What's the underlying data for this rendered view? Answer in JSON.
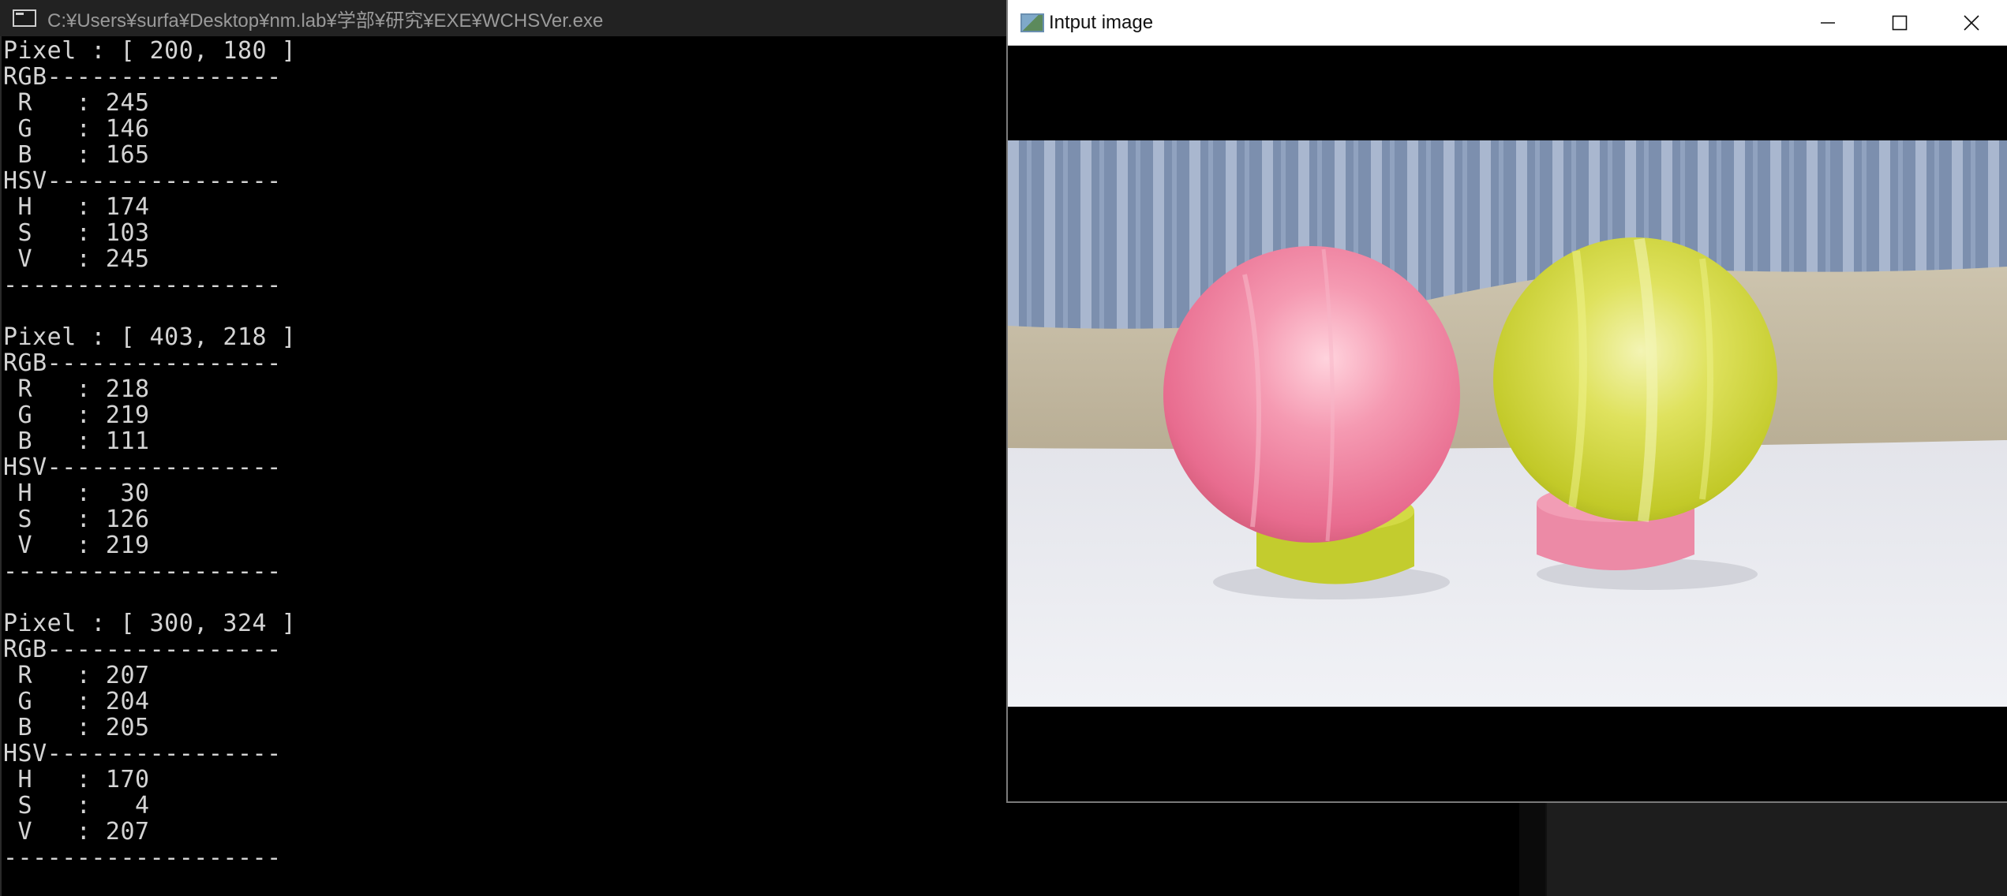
{
  "console": {
    "title": "C:¥Users¥surfa¥Desktop¥nm.lab¥学部¥研究¥EXE¥WCHSVer.exe",
    "blocks": [
      {
        "pixel": "Pixel : [ 200, 180 ]",
        "rgb_header": "RGB----------------",
        "r": " R   : 245",
        "g": " G   : 146",
        "b": " B   : 165",
        "hsv_header": "HSV----------------",
        "h": " H   : 174",
        "s": " S   : 103",
        "v": " V   : 245",
        "sep": "-------------------"
      },
      {
        "pixel": "Pixel : [ 403, 218 ]",
        "rgb_header": "RGB----------------",
        "r": " R   : 218",
        "g": " G   : 219",
        "b": " B   : 111",
        "hsv_header": "HSV----------------",
        "h": " H   :  30",
        "s": " S   : 126",
        "v": " V   : 219",
        "sep": "-------------------"
      },
      {
        "pixel": "Pixel : [ 300, 324 ]",
        "rgb_header": "RGB----------------",
        "r": " R   : 207",
        "g": " G   : 204",
        "b": " B   : 205",
        "hsv_header": "HSV----------------",
        "h": " H   : 170",
        "s": " S   :   4",
        "v": " V   : 207",
        "sep": "-------------------"
      }
    ]
  },
  "image_window": {
    "title": "Intput image",
    "controls": {
      "minimize_icon": "minimize-icon",
      "maximize_icon": "maximize-icon",
      "close_icon": "close-icon"
    }
  },
  "colors": {
    "console_bg": "#000000",
    "console_text": "#d4d4d4",
    "console_titlebar": "#222222",
    "pink_ball": "#f08aa5",
    "yellow_ball": "#d4dc3a",
    "table_surface": "#eef0f4",
    "curtain": "#7f93b0",
    "sand": "#c9bfa8"
  }
}
